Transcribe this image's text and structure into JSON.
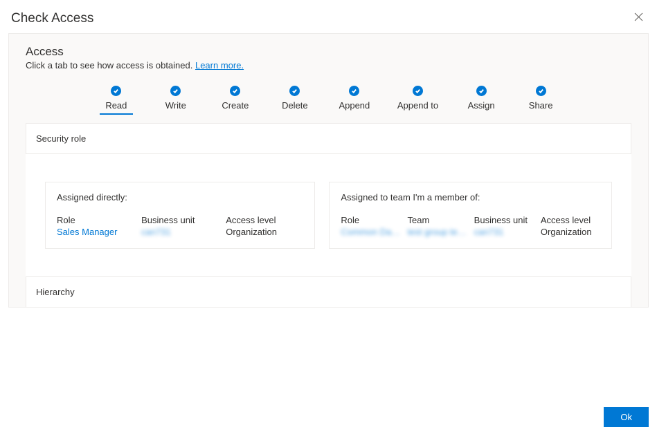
{
  "dialog": {
    "title": "Check Access",
    "closeIcon": "close"
  },
  "access": {
    "heading": "Access",
    "subtext": "Click a tab to see how access is obtained. ",
    "learnMore": "Learn more."
  },
  "tabs": [
    {
      "label": "Read",
      "active": true
    },
    {
      "label": "Write",
      "active": false
    },
    {
      "label": "Create",
      "active": false
    },
    {
      "label": "Delete",
      "active": false
    },
    {
      "label": "Append",
      "active": false
    },
    {
      "label": "Append to",
      "active": false
    },
    {
      "label": "Assign",
      "active": false
    },
    {
      "label": "Share",
      "active": false
    }
  ],
  "securityRole": {
    "heading": "Security role",
    "direct": {
      "title": "Assigned directly:",
      "cols": {
        "roleHead": "Role",
        "roleVal": "Sales Manager",
        "buHead": "Business unit",
        "buVal": "can731",
        "accessHead": "Access level",
        "accessVal": "Organization"
      }
    },
    "team": {
      "title": "Assigned to team I'm a member of:",
      "cols": {
        "roleHead": "Role",
        "roleVal": "Common Data Servi...",
        "teamHead": "Team",
        "teamVal": "test group team",
        "buHead": "Business unit",
        "buVal": "can731",
        "accessHead": "Access level",
        "accessVal": "Organization"
      }
    }
  },
  "hierarchy": {
    "heading": "Hierarchy"
  },
  "footer": {
    "okLabel": "Ok"
  }
}
